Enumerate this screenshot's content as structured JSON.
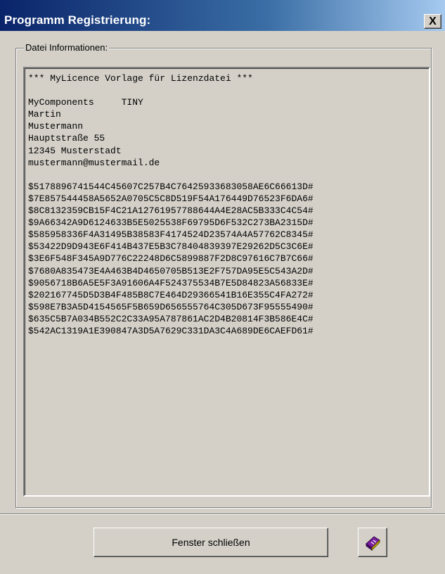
{
  "window": {
    "title": "Programm Registrierung:",
    "close_glyph": "X"
  },
  "group": {
    "label": "Datei Informationen:"
  },
  "memo": {
    "lines": [
      "*** MyLicence Vorlage für Lizenzdatei ***",
      "",
      "MyComponents     TINY",
      "Martin",
      "Mustermann",
      "Hauptstraße 55",
      "12345 Musterstadt",
      "mustermann@mustermail.de",
      "",
      "$5178896741544C45607C257B4C76425933683058AE6C66613D#",
      "$7E857544458A5652A0705C5C8D519F54A176449D76523F6DA6#",
      "$8C8132359CB15F4C21A12761957788644A4E28AC5B333C4C54#",
      "$9A66342A9D6124633B5E5025538F69795D6F532C273BA2315D#",
      "$585958336F4A31495B38583F4174524D23574A4A57762C8345#",
      "$53422D9D943E6F414B437E5B3C78404839397E29262D5C3C6E#",
      "$3E6F548F345A9D776C22248D6C5899887F2D8C97616C7B7C66#",
      "$7680A835473E4A463B4D4650705B513E2F757DA95E5C543A2D#",
      "$9056718B6A5E5F3A91606A4F524375534B7E5D84823A56833E#",
      "$202167745D5D3B4F485B8C7E464D29366541B16E355C4FA272#",
      "$598E7B3A5D4154565F5B659D656555764C305D673F95555490#",
      "$635C5B7A034B552C2C33A95A787861AC2D4B20814F3B586E4C#",
      "$542AC1319A1E390847A3D5A7629C331DA3C4A689DE6CAEFD61#"
    ]
  },
  "buttons": {
    "close_window_label": "Fenster schließen",
    "help_icon": "help-book-icon"
  },
  "colors": {
    "face": "#d4d0c8",
    "title_start": "#0a246a",
    "title_end": "#a6caf0",
    "book_purple": "#7a1fa0",
    "book_yellow": "#f0d000"
  }
}
